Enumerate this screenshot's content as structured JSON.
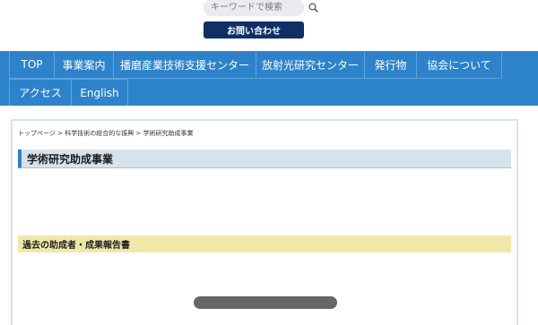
{
  "search": {
    "placeholder": "キーワードで検索",
    "icon": "search-icon"
  },
  "contact": {
    "label": "お問い合わせ"
  },
  "nav": {
    "row1": [
      {
        "label": "TOP",
        "w": 50
      },
      {
        "label": "事業案内",
        "w": 66
      },
      {
        "label": "播磨産業技術支援センター",
        "w": 159
      },
      {
        "label": "放射光研究センター",
        "w": 121
      },
      {
        "label": "発行物",
        "w": 58
      },
      {
        "label": "協会について",
        "w": 96
      }
    ],
    "row2": [
      {
        "label": "アクセス",
        "w": 69
      },
      {
        "label": "English",
        "w": 64
      }
    ]
  },
  "breadcrumb": {
    "items": [
      "トップページ",
      "科学技術の総合的な振興",
      "学術研究助成事業"
    ],
    "separator": " > "
  },
  "page": {
    "title": "学術研究助成事業",
    "section_title": "過去の助成者・成果報告書"
  },
  "colors": {
    "nav_bg": "#2d83cb",
    "contact_bg": "#0f2f69",
    "title_bg": "#d7e3ec",
    "section_bg": "#efe9a9"
  }
}
